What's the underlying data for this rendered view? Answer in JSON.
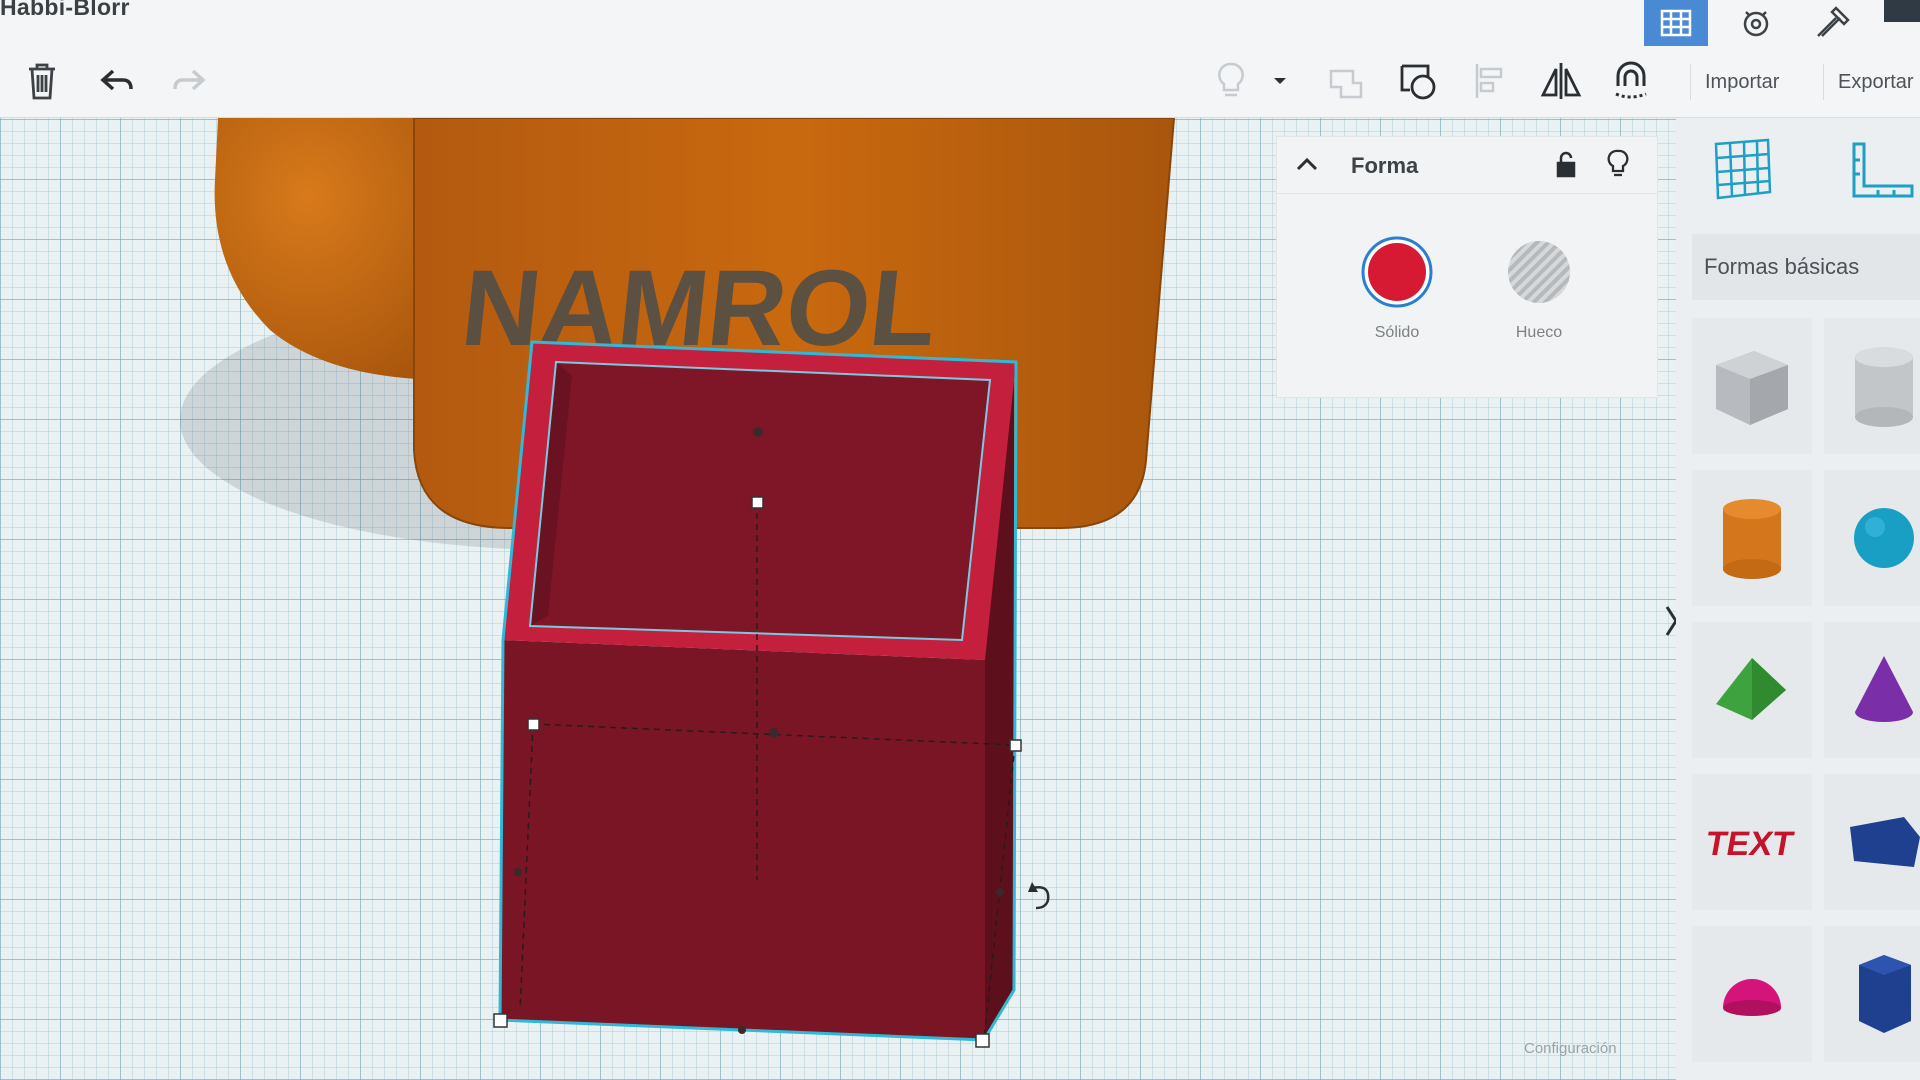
{
  "app": {
    "title": "Habbi-Blorr"
  },
  "toolbar": {
    "delete": "trash-icon",
    "undo": "undo-icon",
    "redo": "redo-icon",
    "import_label": "Importar",
    "export_label": "Exportar"
  },
  "inspector": {
    "title": "Forma",
    "solid_label": "Sólido",
    "hole_label": "Hueco",
    "solid_color": "#d71a33"
  },
  "library": {
    "title": "Formas básicas",
    "shapes": [
      "box",
      "cylinder-hole",
      "cylinder",
      "sphere",
      "roof",
      "cone",
      "text",
      "wedge",
      "half-sphere",
      "polygon"
    ]
  },
  "workplane": {
    "embossed_text": "NAMROL",
    "settings_label": "Configuración"
  },
  "colors": {
    "accent": "#4a8ad4",
    "selection": "#2fb8d8",
    "box": "#7a1526",
    "box_rim": "#c41f3d",
    "orange": "#c8650f"
  }
}
